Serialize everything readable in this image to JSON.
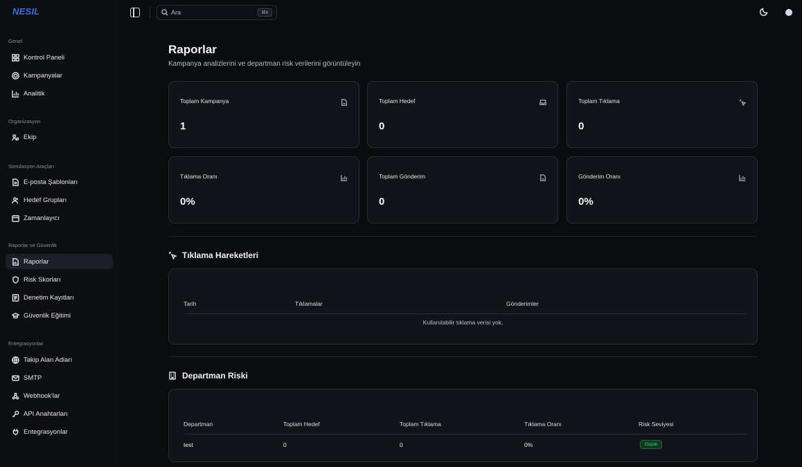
{
  "brand": "NESIL",
  "sidebar": {
    "groups": [
      {
        "title": "Genel",
        "items": [
          {
            "label": "Kontrol Paneli",
            "icon": "grid-icon"
          },
          {
            "label": "Kampanyalar",
            "icon": "target-icon"
          },
          {
            "label": "Analitik",
            "icon": "bar-chart-icon"
          }
        ]
      },
      {
        "title": "Organizasyon",
        "items": [
          {
            "label": "Ekip",
            "icon": "users-icon"
          }
        ]
      },
      {
        "title": "Simülasyon Araçları",
        "items": [
          {
            "label": "E-posta Şablonları",
            "icon": "file-icon"
          },
          {
            "label": "Hedef Grupları",
            "icon": "users-group-icon"
          },
          {
            "label": "Zamanlayıcı",
            "icon": "calendar-icon"
          }
        ]
      },
      {
        "title": "Raporlar ve Güvenlik",
        "items": [
          {
            "label": "Raporlar",
            "icon": "report-icon",
            "active": true
          },
          {
            "label": "Risk Skorları",
            "icon": "shield-icon"
          },
          {
            "label": "Denetim Kayıtları",
            "icon": "log-icon"
          },
          {
            "label": "Güvenlik Eğitimi",
            "icon": "graduation-cap-icon"
          }
        ]
      },
      {
        "title": "Entegrasyonlar",
        "items": [
          {
            "label": "Takip Alan Adları",
            "icon": "globe-icon"
          },
          {
            "label": "SMTP",
            "icon": "mail-icon"
          },
          {
            "label": "Webhook'lar",
            "icon": "webhook-icon"
          },
          {
            "label": "API Anahtarları",
            "icon": "key-icon"
          },
          {
            "label": "Entegrasyonlar",
            "icon": "plug-icon"
          }
        ]
      }
    ]
  },
  "search": {
    "placeholder": "Ara",
    "shortcut": "⌘K"
  },
  "page": {
    "title": "Raporlar",
    "subtitle": "Kampanya analizlerini ve departman risk verilerini görüntüleyin"
  },
  "stats": [
    {
      "label": "Toplam Kampanya",
      "value": "1",
      "icon": "file-icon"
    },
    {
      "label": "Toplam Hedef",
      "value": "0",
      "icon": "inbox-icon"
    },
    {
      "label": "Toplam Tıklama",
      "value": "0",
      "icon": "click-icon"
    },
    {
      "label": "Tıklama Oranı",
      "value": "0%",
      "icon": "bar-chart-icon"
    },
    {
      "label": "Toplam Gönderim",
      "value": "0",
      "icon": "file-icon"
    },
    {
      "label": "Gönderim Oranı",
      "value": "0%",
      "icon": "bar-chart-icon"
    }
  ],
  "clicks_section": {
    "title": "Tıklama Hareketleri",
    "columns": [
      "Tarih",
      "Tıklamalar",
      "Gönderimler"
    ],
    "empty_message": "Kullanılabilir tıklama verisi yok."
  },
  "department_section": {
    "title": "Departman Riski",
    "columns": [
      "Departman",
      "Toplam Hedef",
      "Toplam Tıklama",
      "Tıklama Oranı",
      "Risk Seviyesi"
    ],
    "rows": [
      {
        "department": "test",
        "targets": "0",
        "clicks": "0",
        "rate": "0%",
        "risk": "Düşük"
      }
    ]
  },
  "colors": {
    "accent": "#3b6fe0",
    "risk_low": "#3fd07a",
    "background": "#0b0c10"
  }
}
